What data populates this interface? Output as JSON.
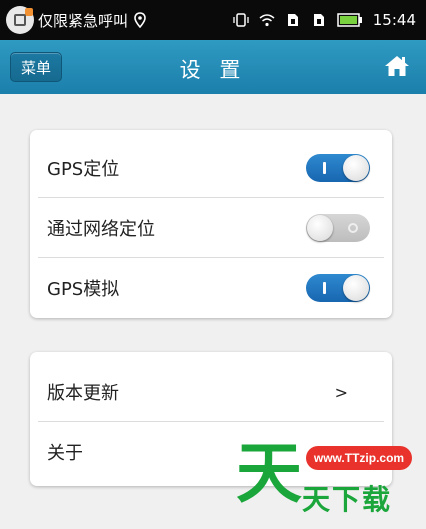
{
  "status_bar": {
    "notification_text": "仅限紧急呼叫",
    "time": "15:44",
    "icons": [
      "app-icon",
      "location-icon",
      "vibrate-icon",
      "wifi-icon",
      "sim1-icon",
      "sim2-icon",
      "battery-icon"
    ]
  },
  "header": {
    "menu_label": "菜单",
    "title": "设 置",
    "home_icon": "home-icon",
    "color": "#2189b7"
  },
  "settings": [
    {
      "label": "GPS定位",
      "enabled": true
    },
    {
      "label": "通过网络定位",
      "enabled": false
    },
    {
      "label": "GPS模拟",
      "enabled": true
    }
  ],
  "more": {
    "update_label": "版本更新",
    "update_chevron": ">",
    "about_label": "关于"
  },
  "watermark": {
    "url": "www.TTzip.com",
    "logo_char": "天",
    "name": "天下载"
  },
  "colors": {
    "accent": "#1b75c6",
    "watermark_green": "#1aa63a",
    "watermark_red": "#e8322b"
  }
}
